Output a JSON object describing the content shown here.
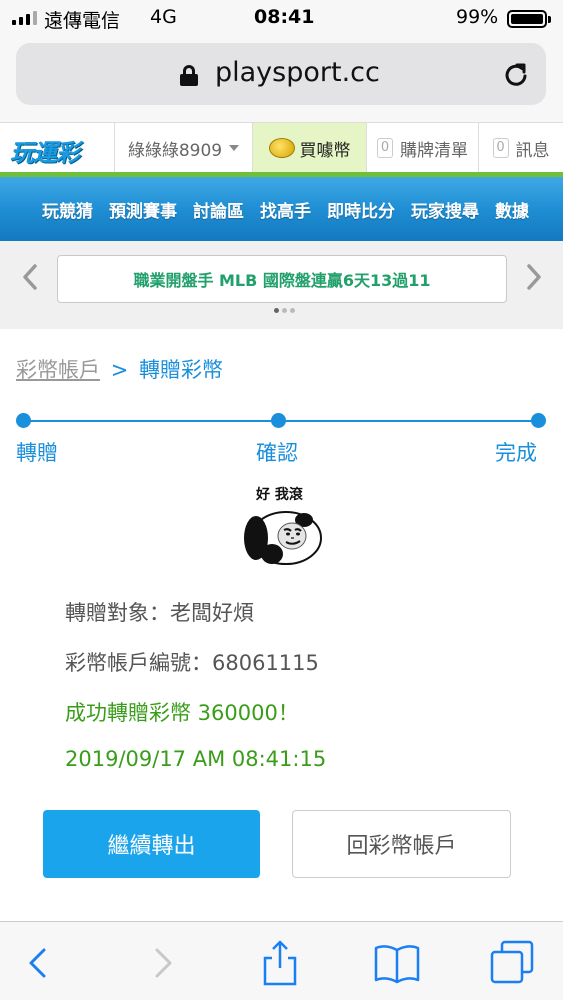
{
  "status": {
    "carrier": "遠傳電信",
    "network": "4G",
    "time": "08:41",
    "battery_pct": "99%"
  },
  "browser": {
    "url": "playsport.cc"
  },
  "site": {
    "logo": "玩運彩",
    "username": "綠綠綠8909",
    "buy_coins": "買噱幣",
    "coin_icon_text": "噱",
    "ticket_count": "0",
    "ticket_label": "購牌清單",
    "msg_count": "0",
    "msg_label": "訊息"
  },
  "nav": {
    "items": [
      "玩競猜",
      "預測賽事",
      "討論區",
      "找高手",
      "即時比分",
      "玩家搜尋",
      "數據"
    ]
  },
  "ticker": {
    "text": "職業開盤手 MLB 國際盤連贏6天13過11"
  },
  "breadcrumb": {
    "parent": "彩幣帳戶",
    "separator": ">",
    "current": "轉贈彩幣"
  },
  "steps": {
    "labels": [
      "轉贈",
      "確認",
      "完成"
    ]
  },
  "meme": {
    "caption": "好 我滾"
  },
  "result": {
    "recipient": "轉贈對象：老闆好煩",
    "account": "彩幣帳戶編號：68061115",
    "success": "成功轉贈彩幣 360000！",
    "timestamp": "2019/09/17 AM 08:41:15"
  },
  "buttons": {
    "continue": "繼續轉出",
    "back": "回彩幣帳戶"
  },
  "colors": {
    "accent": "#1a8fdc",
    "success": "#3a9d1a",
    "primary_button": "#1aa4ec"
  }
}
